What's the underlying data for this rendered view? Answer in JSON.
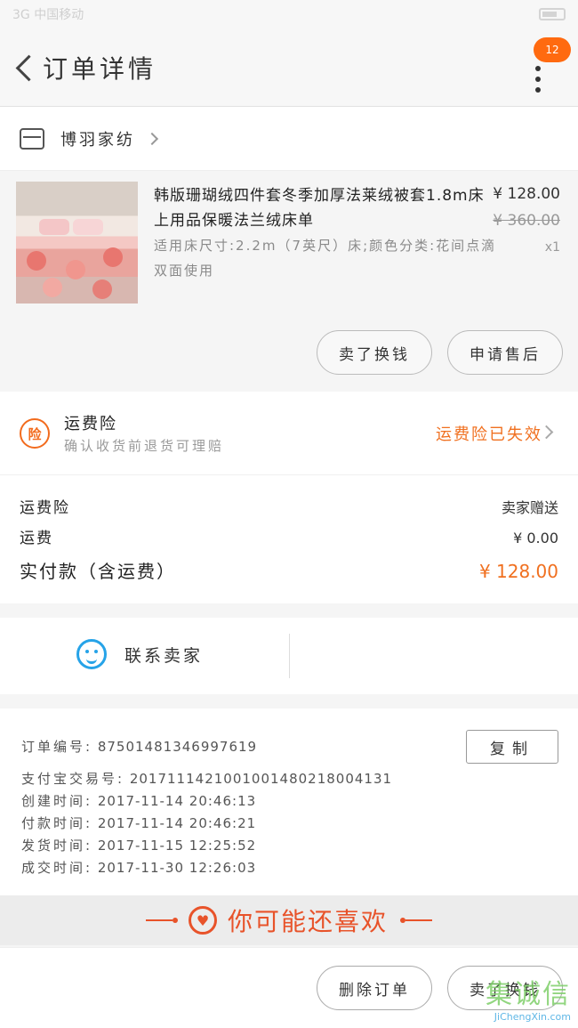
{
  "status_bar": {
    "left": "3G 中国移动",
    "time": ""
  },
  "header": {
    "title": "订单详情",
    "badge": "12"
  },
  "shop": {
    "name": "博羽家纺"
  },
  "product": {
    "title": "韩版珊瑚绒四件套冬季加厚法莱绒被套1.8m床上用品保暖法兰绒床单",
    "spec": "适用床尺寸:2.2m（7英尺）床;颜色分类:花间点滴双面使用",
    "price": "¥ 128.00",
    "original_price": "¥ 360.00",
    "quantity": "x1",
    "buttons": {
      "rebuy": "卖了换钱",
      "after_sale": "申请售后"
    }
  },
  "insurance": {
    "icon_text": "险",
    "title": "运费险",
    "subtitle": "确认收货前退货可理赔",
    "status": "运费险已失效"
  },
  "fees": {
    "insurance_label": "运费险",
    "insurance_value": "卖家赠送",
    "shipping_label": "运费",
    "shipping_value": "¥ 0.00",
    "total_label": "实付款（含运费）",
    "total_value": "¥ 128.00"
  },
  "contact": {
    "label": "联系卖家"
  },
  "order_info": {
    "copy_button": "复制",
    "order_no_label": "订单编号:",
    "order_no": "87501481346997619",
    "alipay_label": "支付宝交易号:",
    "alipay_no": "2017111421001001480218004131",
    "created_label": "创建时间:",
    "created": "2017-11-14 20:46:13",
    "paid_label": "付款时间:",
    "paid": "2017-11-14 20:46:21",
    "shipped_label": "发货时间:",
    "shipped": "2017-11-15 12:25:52",
    "completed_label": "成交时间:",
    "completed": "2017-11-30 12:26:03"
  },
  "recommend": {
    "title": "你可能还喜欢"
  },
  "bottom": {
    "delete_order": "删除订单",
    "sell_again": "卖了换钱"
  },
  "watermark": {
    "cn": "集诚信",
    "en": "JiChengXin.com"
  },
  "colors": {
    "accent": "#f07020",
    "blue": "#26a3e8",
    "recommend": "#e8532a"
  }
}
